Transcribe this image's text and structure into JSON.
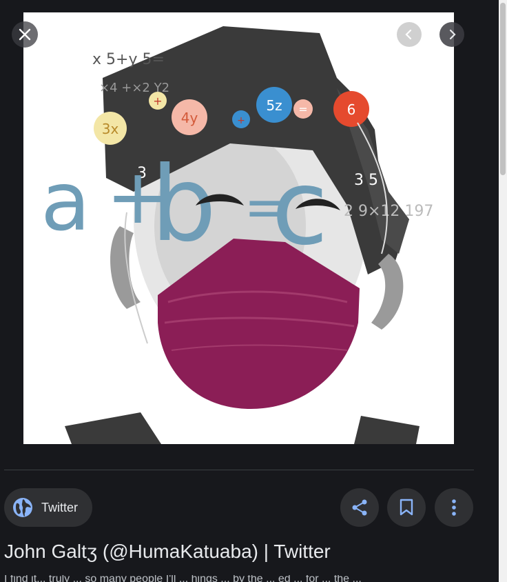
{
  "viewer": {
    "close_label": "Close",
    "prev_label": "Previous",
    "next_label": "Next"
  },
  "image": {
    "alt": "Illustration of a face wearing a maroon mask with math formulas",
    "formula_top": "x 5+y 5=",
    "formula_sub": "×4 +×2 Y2",
    "bubbles": [
      "3x",
      "+",
      "4y",
      "+",
      "5z",
      "=",
      "6"
    ],
    "big_formula": [
      "a",
      "+",
      "b",
      "=",
      "c"
    ],
    "right_text": "3 5",
    "right_numbers": "2 9×12 197",
    "left_numbers": "3",
    "colors": {
      "blue": "#6f9db7",
      "mask": "#8b1e56",
      "dark_hair": "#3a3a3a",
      "bubble_red": "#e54a2e",
      "bubble_blue": "#3a8fd0",
      "bubble_yellow": "#f3e6a6",
      "bubble_pink": "#f5b8a8"
    }
  },
  "source": {
    "name": "Twitter",
    "icon": "globe-icon"
  },
  "actions": {
    "share_icon": "share-icon",
    "save_icon": "bookmark-icon",
    "more_icon": "more-vert-icon"
  },
  "result": {
    "title": "John Galtʒ (@HumaKatuaba) | Twitter",
    "snippet": "I find it... truly ... so many people I'll ... hings ... by the ... ed ... for ... the ..."
  },
  "theme": {
    "background": "#17181c",
    "chip": "#2f3033",
    "accent": "#8ab4f8",
    "text": "#e8eaed"
  }
}
